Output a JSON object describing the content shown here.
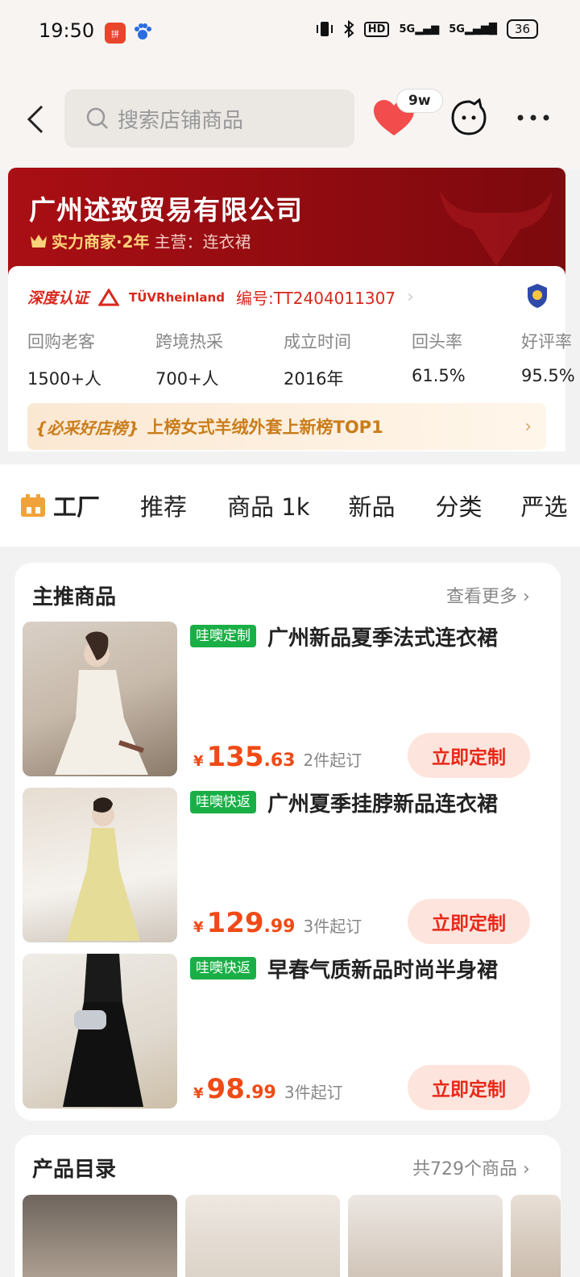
{
  "status_bar": {
    "time": "19:50",
    "app_icons": [
      "pinduoduo-app-icon",
      "baidu-app-icon"
    ],
    "network": [
      "HD",
      "5G",
      "5G"
    ],
    "battery": "36"
  },
  "header": {
    "search_placeholder": "搜索店铺商品",
    "favorite_count": "9w",
    "icons": [
      "back-icon",
      "search-icon",
      "heart-icon",
      "chat-bot-icon",
      "more-icon"
    ]
  },
  "shop": {
    "name": "广州述致贸易有限公司",
    "level": "实力商家·2年",
    "main_business": "主营：连衣裙",
    "certification": {
      "label": "深度认证",
      "partner": "TÜVRheinland",
      "number": "编号:TT2404011307"
    },
    "stats": [
      {
        "label": "回购老客",
        "value": "1500+人"
      },
      {
        "label": "跨境热采",
        "value": "700+人"
      },
      {
        "label": "成立时间",
        "value": "2016年"
      },
      {
        "label": "回头率",
        "value": "61.5%"
      },
      {
        "label": "好评率",
        "value": "95.5%"
      }
    ],
    "ranking": {
      "badge": "必采好店榜",
      "text": "上榜女式羊绒外套上新榜TOP1"
    }
  },
  "tabs": [
    {
      "label": "工厂",
      "active": true
    },
    {
      "label": "推荐"
    },
    {
      "label": "商品 1k"
    },
    {
      "label": "新品"
    },
    {
      "label": "分类"
    },
    {
      "label": "严选"
    }
  ],
  "featured": {
    "title": "主推商品",
    "more": "查看更多",
    "products": [
      {
        "tag": "哇噢定制",
        "title": "广州新品夏季法式连衣裙",
        "price_int": "135",
        "price_dec": ".63",
        "moq": "2件起订",
        "cta": "立即定制"
      },
      {
        "tag": "哇噢快返",
        "title": "广州夏季挂脖新品连衣裙",
        "price_int": "129",
        "price_dec": ".99",
        "moq": "3件起订",
        "cta": "立即定制"
      },
      {
        "tag": "哇噢快返",
        "title": "早春气质新品时尚半身裙",
        "price_int": "98",
        "price_dec": ".99",
        "moq": "3件起订",
        "cta": "立即定制"
      }
    ]
  },
  "catalog": {
    "title": "产品目录",
    "count": "共729个商品"
  },
  "colors": {
    "banner_red": "#9e0e13",
    "price_orange": "#f04a16",
    "tag_green": "#1aaf46",
    "cta_bg": "#fde5dd",
    "cta_text": "#e8281a"
  }
}
